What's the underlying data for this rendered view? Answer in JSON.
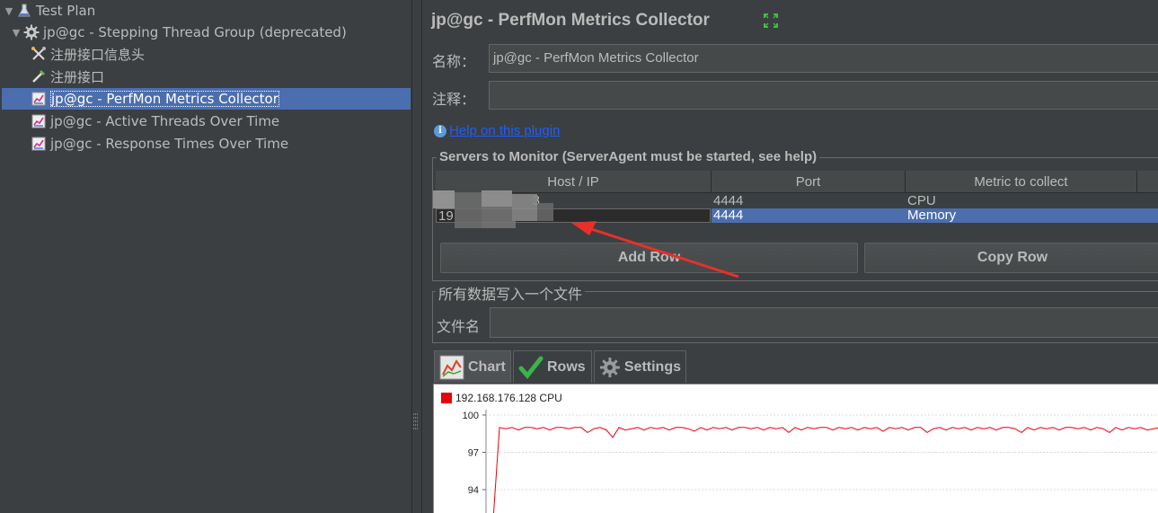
{
  "tree": {
    "items": [
      {
        "label": "Test Plan",
        "arrow": "▼",
        "icon": "flask-icon",
        "depth": 0
      },
      {
        "label": "jp@gc - Stepping Thread Group (deprecated)",
        "arrow": "▼",
        "icon": "gear-icon",
        "depth": 1
      },
      {
        "label": "注册接口信息头",
        "arrow": "",
        "icon": "wrench-scissors-icon",
        "depth": 2
      },
      {
        "label": "注册接口",
        "arrow": "",
        "icon": "pipette-icon",
        "depth": 2
      },
      {
        "label": "jp@gc - PerfMon Metrics Collector",
        "arrow": "",
        "icon": "graph-icon",
        "depth": 2,
        "selected": true
      },
      {
        "label": "jp@gc - Active Threads Over Time",
        "arrow": "",
        "icon": "graph-icon",
        "depth": 2
      },
      {
        "label": "jp@gc - Response Times Over Time",
        "arrow": "",
        "icon": "graph-icon",
        "depth": 2
      }
    ]
  },
  "panel": {
    "title": "jp@gc - PerfMon Metrics Collector",
    "name_label": "名称：",
    "name_value": "jp@gc - PerfMon Metrics Collector",
    "comment_label": "注释：",
    "comment_value": "",
    "help_link": "Help on this plugin"
  },
  "servers": {
    "group_title": "Servers to Monitor (ServerAgent must be started, see help)",
    "columns": [
      "Host / IP",
      "Port",
      "Metric to collect"
    ],
    "rows": [
      {
        "host": "3",
        "port": "4444",
        "metric": "CPU",
        "selected": false
      },
      {
        "host": "19",
        "port": "4444",
        "metric": "Memory",
        "selected": true
      }
    ],
    "add_row": "Add Row",
    "copy_row": "Copy Row"
  },
  "file": {
    "group_title": "所有数据写入一个文件",
    "label": "文件名",
    "value": ""
  },
  "tabs": [
    {
      "label": "Chart",
      "icon": "chart-icon",
      "active": true
    },
    {
      "label": "Rows",
      "icon": "checkmark-icon",
      "active": false
    },
    {
      "label": "Settings",
      "icon": "gear-icon",
      "active": false
    }
  ],
  "colors": {
    "series": "#e8000b",
    "selection": "#4b6eaf",
    "link": "#1e5eff"
  },
  "chart_data": {
    "type": "line",
    "series": [
      {
        "name": "192.168.176.128 CPU",
        "values": [
          0,
          0,
          99,
          98.9,
          99,
          98.8,
          99,
          99,
          98.9,
          99,
          98.8,
          99,
          99,
          98.9,
          99,
          99,
          98.6,
          98.9,
          99,
          98.8,
          98.2,
          99,
          98.8,
          98.9,
          99,
          98.8,
          99,
          98.9,
          99,
          98.8,
          99,
          99,
          98.9,
          98.7,
          99,
          98.8,
          99,
          98.9,
          99,
          98.8,
          99,
          99,
          98.9,
          99,
          98.8,
          99,
          98.9,
          99,
          98.6,
          99,
          98.8,
          99,
          98.9,
          99,
          99,
          98.8,
          99,
          98.9,
          99,
          98.8,
          99,
          98.9,
          99,
          98.7,
          99,
          98.9,
          99,
          98.8,
          99,
          99,
          98.6,
          98.9,
          99,
          98.8,
          99,
          98.9,
          99,
          98.8,
          99,
          98.9,
          99,
          98.8,
          99,
          99,
          98.9,
          98.6,
          99,
          98.8,
          99,
          98.9,
          99,
          98.8,
          99,
          99,
          98.9,
          99,
          98.8,
          99,
          98.9,
          98.6,
          99,
          98.8,
          99,
          98.9,
          99,
          98.8,
          98.9,
          99,
          98.8,
          99
        ]
      }
    ],
    "yticks": [
      100,
      97,
      94
    ],
    "ylim": [
      91.5,
      100
    ],
    "title": "",
    "xlabel": "",
    "ylabel": "",
    "legend": "top-left"
  }
}
